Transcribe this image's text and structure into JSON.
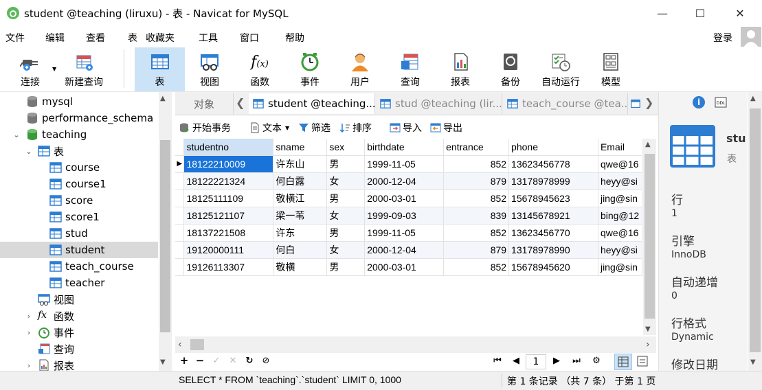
{
  "window": {
    "title": "student @teaching (liruxu) - 表 - Navicat for MySQL",
    "minimize": "—",
    "maximize": "☐",
    "close": "✕"
  },
  "menu": {
    "items": [
      "文件",
      "编辑",
      "查看",
      "表",
      "收藏夹",
      "工具",
      "窗口",
      "帮助"
    ],
    "login": "登录"
  },
  "toolbar": {
    "items": [
      {
        "label": "连接",
        "icon": "plug-icon"
      },
      {
        "label": "新建查询",
        "icon": "new-query-icon"
      },
      {
        "label": "表",
        "icon": "table-icon"
      },
      {
        "label": "视图",
        "icon": "view-icon"
      },
      {
        "label": "函数",
        "icon": "function-icon"
      },
      {
        "label": "事件",
        "icon": "clock-icon"
      },
      {
        "label": "用户",
        "icon": "user-icon"
      },
      {
        "label": "查询",
        "icon": "query-icon"
      },
      {
        "label": "报表",
        "icon": "report-icon"
      },
      {
        "label": "备份",
        "icon": "backup-icon"
      },
      {
        "label": "自动运行",
        "icon": "autorun-icon"
      },
      {
        "label": "模型",
        "icon": "model-icon"
      }
    ],
    "active": "表"
  },
  "tree": {
    "mysql": "mysql",
    "performance_schema": "performance_schema",
    "teaching": "teaching",
    "tables_group": "表",
    "tables": [
      "course",
      "course1",
      "score",
      "score1",
      "stud",
      "student",
      "teach_course",
      "teacher"
    ],
    "selected_table": "student",
    "views": "视图",
    "functions": "函数",
    "events": "事件",
    "queries": "查询",
    "reports": "报表"
  },
  "tabs": {
    "objects": "对象",
    "items": [
      "student @teaching...",
      "stud @teaching (lir...",
      "teach_course @tea..."
    ]
  },
  "subtoolbar": {
    "begin_tx": "开始事务",
    "text": "文本",
    "filter": "筛选",
    "sort": "排序",
    "import": "导入",
    "export": "导出"
  },
  "grid": {
    "columns": [
      "studentno",
      "sname",
      "sex",
      "birthdate",
      "entrance",
      "phone",
      "Email"
    ],
    "rows": [
      [
        "18122210009",
        "许东山",
        "男",
        "1999-11-05",
        "852",
        "13623456778",
        "qwe@16"
      ],
      [
        "18122221324",
        "何白露",
        "女",
        "2000-12-04",
        "879",
        "13178978999",
        "heyy@si"
      ],
      [
        "18125111109",
        "敬横江",
        "男",
        "2000-03-01",
        "852",
        "15678945623",
        "jing@sin"
      ],
      [
        "18125121107",
        "梁一苇",
        "女",
        "1999-09-03",
        "839",
        "13145678921",
        "bing@12"
      ],
      [
        "18137221508",
        "许东",
        "男",
        "1999-11-05",
        "852",
        "13623456770",
        "qwe@16"
      ],
      [
        "19120000111",
        "何白",
        "女",
        "2000-12-04",
        "879",
        "13178978990",
        "heyy@si"
      ],
      [
        "19126113307",
        "敬横",
        "男",
        "2000-03-01",
        "852",
        "15678945620",
        "jing@sin"
      ]
    ]
  },
  "bottomnav": {
    "add": "+",
    "remove": "−",
    "apply": "✓",
    "discard": "✕",
    "refresh": "↻",
    "stop": "⊘",
    "first": "⏮",
    "prev": "◀",
    "page": "1",
    "next": "▶",
    "last": "⏭",
    "settings": "⚙"
  },
  "status": {
    "sql": "SELECT * FROM `teaching`.`student` LIMIT 0, 1000",
    "records": "第 1 条记录 （共 7 条） 于第 1 页"
  },
  "right_panel": {
    "name": "stu",
    "type": "表",
    "rows_label": "行",
    "rows_value": "1",
    "engine_label": "引擎",
    "engine_value": "InnoDB",
    "autoinc_label": "自动递增",
    "autoinc_value": "0",
    "rowformat_label": "行格式",
    "rowformat_value": "Dynamic",
    "modified_label": "修改日期"
  }
}
